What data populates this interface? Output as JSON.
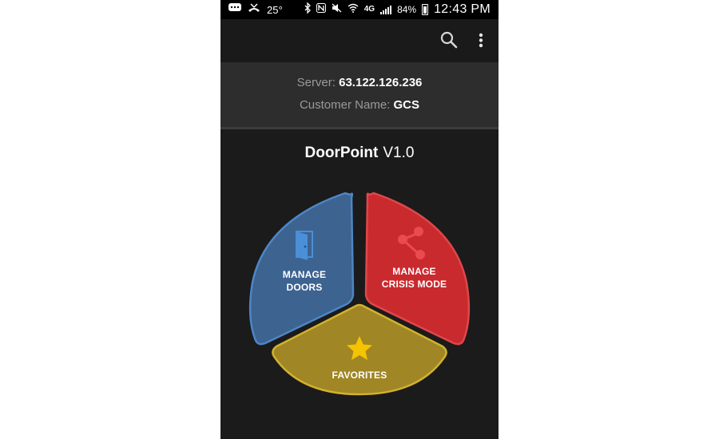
{
  "status_bar": {
    "temperature": "25°",
    "network": "4G",
    "battery": "84%",
    "time": "12:43 PM"
  },
  "toolbar": {
    "search_icon": "search-icon",
    "menu_icon": "more-vert-icon"
  },
  "server_info": {
    "server_label": "Server:",
    "server_value": "63.122.126.236",
    "customer_label": "Customer Name:",
    "customer_value": "GCS"
  },
  "app": {
    "name": "DoorPoint",
    "version": "V1.0"
  },
  "menu": {
    "manage_doors": {
      "line1": "MANAGE",
      "line2": "DOORS",
      "icon": "door-icon",
      "color": "#3d6390"
    },
    "manage_crisis": {
      "line1": "MANAGE",
      "line2": "CRISIS MODE",
      "icon": "share-nodes-icon",
      "color": "#c92a2e"
    },
    "favorites": {
      "line1": "FAVORITES",
      "icon": "star-icon",
      "color": "#a08624"
    }
  },
  "colors": {
    "background": "#1b1b1b",
    "panel": "#2d2d2d",
    "star": "#f5c400"
  }
}
